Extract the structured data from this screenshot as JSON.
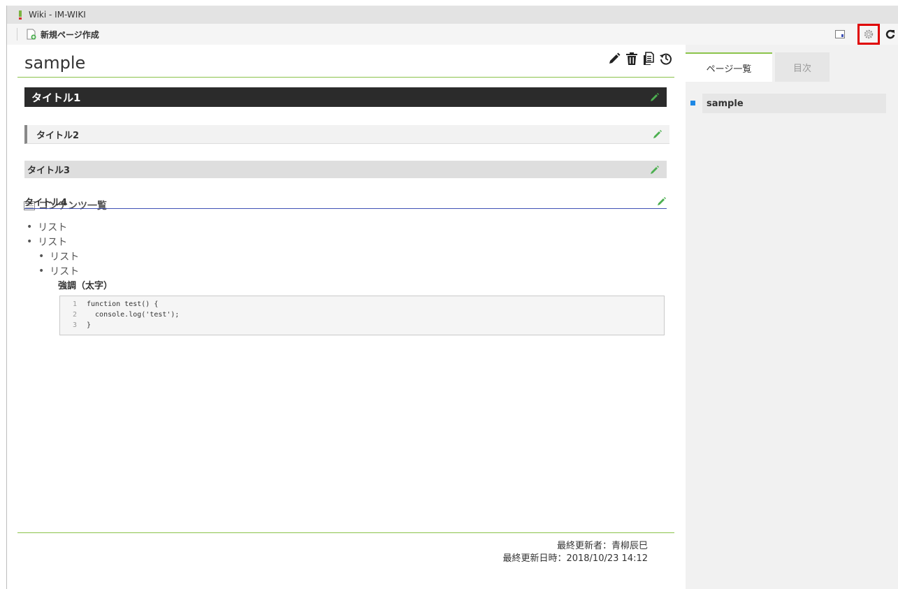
{
  "window": {
    "title": "Wiki - IM-WIKI"
  },
  "toolbar": {
    "contents_list_label": "コンテンツ一覧",
    "new_page_label": "新規ページ作成"
  },
  "page": {
    "title": "sample"
  },
  "content": {
    "headings": [
      "タイトル1",
      "タイトル2",
      "タイトル3",
      "タイトル4"
    ],
    "list": {
      "items": [
        "リスト",
        "リスト"
      ],
      "sub_items": [
        "リスト",
        "リスト"
      ],
      "strong_text": "強調（太字）"
    },
    "code": {
      "lines": [
        {
          "num": "1",
          "text": "function test() {"
        },
        {
          "num": "2",
          "text": "  console.log('test');"
        },
        {
          "num": "3",
          "text": "}"
        }
      ]
    }
  },
  "footer": {
    "updated_by": "最終更新者：青柳辰巳",
    "updated_at": "最終更新日時：2018/10/23 14:12"
  },
  "sidebar": {
    "tabs": [
      "ページ一覧",
      "目次"
    ],
    "pages": [
      "sample"
    ]
  },
  "colors": {
    "accent_green": "#8bc34a",
    "highlight_red": "#e00000",
    "bullet_blue": "#1e88e5",
    "edit_icon_green": "#4caf50"
  },
  "icons": {
    "toolbar": [
      "contents-list-icon",
      "new-page-icon",
      "panel-toggle-icon",
      "gear-icon",
      "refresh-icon"
    ],
    "page_actions": [
      "pencil-icon",
      "trash-icon",
      "copy-icon",
      "history-icon"
    ],
    "heading_edit": "pencil-icon"
  }
}
